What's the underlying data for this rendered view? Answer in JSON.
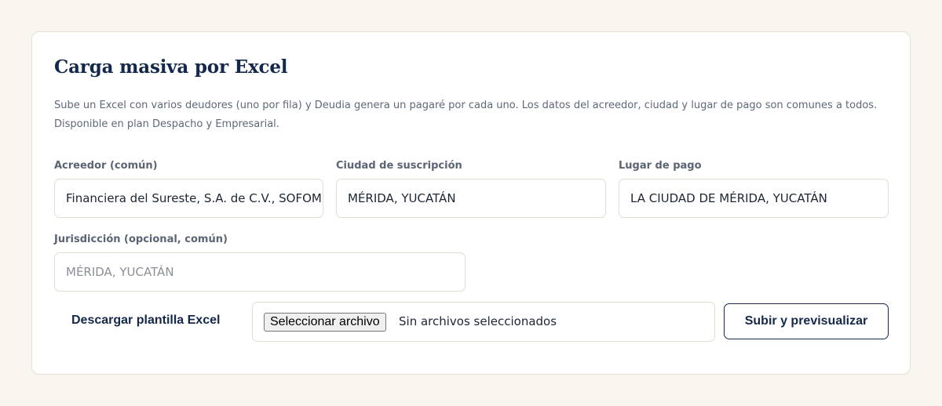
{
  "section": {
    "title": "Carga masiva por Excel",
    "description": "Sube un Excel con varios deudores (uno por fila) y Deudia genera un pagaré por cada uno. Los datos del acreedor, ciudad y lugar de pago son comunes a todos. Disponible en plan Despacho y Empresarial."
  },
  "fields": {
    "acreedor": {
      "label": "Acreedor (común)",
      "value": "Financiera del Sureste, S.A. de C.V., SOFOM"
    },
    "ciudad": {
      "label": "Ciudad de suscripción",
      "value": "MÉRIDA, YUCATÁN"
    },
    "lugar": {
      "label": "Lugar de pago",
      "value": "LA CIUDAD DE MÉRIDA, YUCATÁN"
    },
    "jurisdiccion": {
      "label": "Jurisdicción (opcional, común)",
      "placeholder": "MÉRIDA, YUCATÁN"
    }
  },
  "actions": {
    "download_template": "Descargar plantilla Excel",
    "file_button": "Seleccionar archivo",
    "file_status": "Sin archivos seleccionados",
    "submit": "Subir y previsualizar"
  },
  "colors": {
    "background": "#f9f6f0",
    "accent": "#14284b",
    "border": "#e3ddcf"
  }
}
